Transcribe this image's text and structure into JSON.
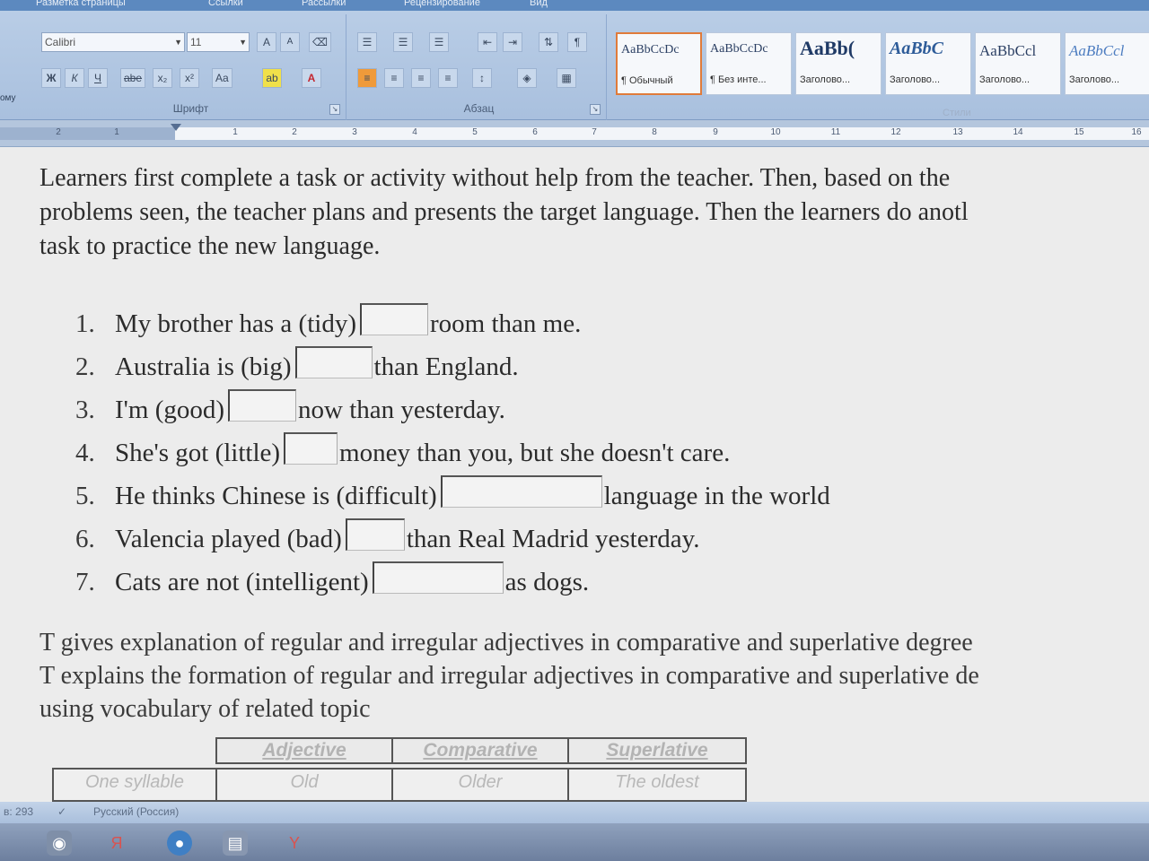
{
  "ribbon": {
    "tabs": [
      "Разметка страницы",
      "Ссылки",
      "Рассылки",
      "Рецензирование",
      "Вид"
    ],
    "font_name": "Calibri",
    "font_size": "11",
    "font_group_label": "Шрифт",
    "paragraph_group_label": "Абзац",
    "styles_group_label": "Стили",
    "side_stub": "ому",
    "grow_font": "A",
    "shrink_font": "A",
    "bold": "Ж",
    "italic": "К",
    "underline": "Ч",
    "strike": "abe",
    "subscript": "x₂",
    "superscript": "x²",
    "change_case": "Aa",
    "highlight": "ab",
    "font_color": "A",
    "show_marks": "¶",
    "styles": [
      {
        "sample": "AaBbCcDc",
        "name": "¶ Обычный",
        "selected": true
      },
      {
        "sample": "AaBbCcDc",
        "name": "¶ Без инте...",
        "selected": false
      },
      {
        "sample": "AaBb(",
        "name": "Заголово...",
        "selected": false
      },
      {
        "sample": "AaBbC",
        "name": "Заголово...",
        "selected": false
      },
      {
        "sample": "AaBbCcl",
        "name": "Заголово...",
        "selected": false
      },
      {
        "sample": "AaBbCcl",
        "name": "Заголово...",
        "selected": false
      }
    ]
  },
  "ruler": {
    "left_ticks": [
      "2",
      "1"
    ],
    "ticks": [
      "1",
      "2",
      "3",
      "4",
      "5",
      "6",
      "7",
      "8",
      "9",
      "10",
      "11",
      "12",
      "13",
      "14",
      "15",
      "16"
    ]
  },
  "document": {
    "intro_lines": [
      "Learners first complete a task or activity without help from the teacher. Then, based on the",
      "problems seen, the teacher plans and presents the target language. Then the learners do anotl",
      "task to practice the new language."
    ],
    "exercises": [
      {
        "num": "1.",
        "before": "My brother has a (tidy)",
        "after": "room than me."
      },
      {
        "num": "2.",
        "before": "Australia is (big)",
        "after": "than England."
      },
      {
        "num": "3.",
        "before": "I'm (good)",
        "after": "now than yesterday."
      },
      {
        "num": "4.",
        "before": "She's got (little)",
        "after": "money than you, but she doesn't care."
      },
      {
        "num": "5.",
        "before": "He thinks Chinese is (difficult)",
        "after": "language in the world"
      },
      {
        "num": "6.",
        "before": "Valencia played (bad)",
        "after": "than Real Madrid yesterday."
      },
      {
        "num": "7.",
        "before": "Cats are not (intelligent)",
        "after": "as dogs."
      }
    ],
    "teacher_lines": [
      "T gives explanation of regular and irregular adjectives in comparative and superlative degree",
      "T explains the formation of regular and irregular adjectives in comparative and superlative de",
      "using vocabulary of related topic"
    ],
    "table": {
      "headers": [
        "Adjective",
        "Comparative",
        "Superlative"
      ],
      "row": {
        "label": "One syllable",
        "cells": [
          "Old",
          "Older",
          "The oldest"
        ]
      }
    }
  },
  "status": {
    "page_info": "в: 293",
    "language": "Русский (Россия)"
  },
  "colors": {
    "ribbon_blue": "#a9c0de",
    "selected_style_border": "#e07b3a",
    "font_color_red": "#c4262e"
  }
}
